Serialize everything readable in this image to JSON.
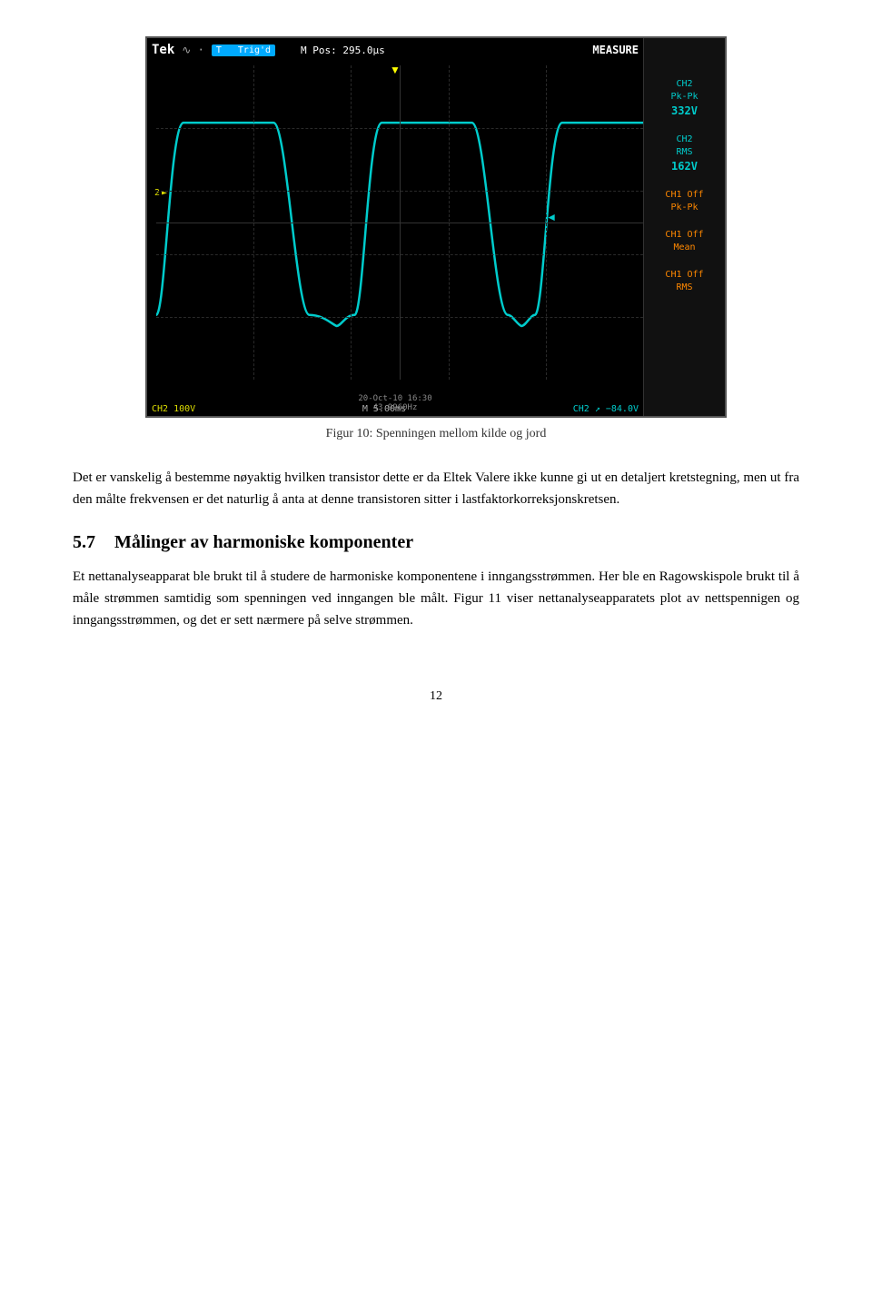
{
  "oscilloscope": {
    "header": {
      "brand": "Tek",
      "trig_label": "Trig'd",
      "trig_channel": "T",
      "m_pos": "M Pos: 295.0μs",
      "measure_title": "MEASURE"
    },
    "measurements": [
      {
        "id": "ch2-pk-pk",
        "line1": "CH2",
        "line2": "Pk-Pk",
        "line3": "332V",
        "color": "cyan"
      },
      {
        "id": "ch2-rms",
        "line1": "CH2",
        "line2": "RMS",
        "line3": "162V",
        "color": "cyan"
      },
      {
        "id": "ch1-off-pk-pk",
        "line1": "CH1 Off",
        "line2": "Pk-Pk",
        "line3": "",
        "color": "orange"
      },
      {
        "id": "ch1-off-mean",
        "line1": "CH1 Off",
        "line2": "Mean",
        "line3": "",
        "color": "orange"
      },
      {
        "id": "ch1-off-rms",
        "line1": "CH1 Off",
        "line2": "RMS",
        "line3": "",
        "color": "orange"
      }
    ],
    "footer": {
      "ch2_scale": "CH2 100V",
      "time_scale": "M 5.00ms",
      "ch2_trigger": "CH2 ↗ −84.0V",
      "date": "20-Oct-10 16:30",
      "freq": "43.9960Hz"
    },
    "ch2_marker": "2",
    "trigger_arrow": "▼"
  },
  "figure_caption": "Figur 10: Spenningen mellom kilde og jord",
  "paragraph1": "Det er vanskelig å bestemme nøyaktig hvilken transistor dette er da Eltek Valere ikke kunne gi ut en detaljert kretstegning, men ut fra den målte frekvensen er det naturlig å anta at denne transistoren sitter i lastfaktorkorreksjonskretsen.",
  "section": {
    "number": "5.7",
    "title": "Målinger av harmoniske komponenter"
  },
  "paragraph2": "Et nettanalyseapparat ble brukt til å studere de harmoniske komponentene i inngangsstrømmen. Her ble en Ragowskispole brukt til å måle strømmen samtidig som spenningen ved inngangen ble målt. Figur 11 viser nettanalyseapparatets plot av nettspennigen og inngangsstrømmen, og det er sett nærmere på selve strømmen.",
  "page_number": "12"
}
